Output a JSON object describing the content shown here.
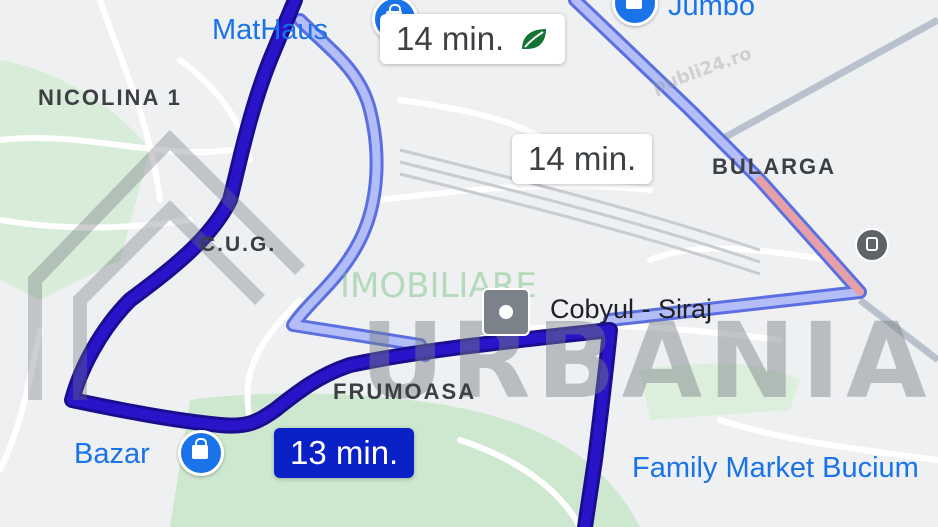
{
  "areas": {
    "nicolina": "NICOLINA 1",
    "bularga": "BULARGA",
    "cug": "C.U.G.",
    "frumoasa": "FRUMOASA"
  },
  "pois": {
    "mathaus": "MatHaus",
    "jumbo": "Jumbo",
    "cobyul": "Cobyul - Siraj",
    "bazar": "Bazar",
    "family_market": "Family Market Bucium"
  },
  "routes": [
    {
      "duration": "14 min.",
      "eco": true
    },
    {
      "duration": "14 min.",
      "eco": false
    },
    {
      "duration": "13 min.",
      "selected": true
    }
  ],
  "watermark": {
    "brand": "URBANIA",
    "tagline": "IMOBILIARE",
    "site": "publi24.ro"
  },
  "colors": {
    "selected_route": "#2a14c9",
    "alt_route": "#a9b4f5",
    "callout_active": "#0b21c8",
    "park": "#c8e6c9",
    "poi_blue": "#1a73e8",
    "traffic": "#e8a0a8"
  },
  "icons": [
    "shopping-pin-icon",
    "leaf-icon",
    "transit-stop-icon",
    "train-station-icon"
  ]
}
